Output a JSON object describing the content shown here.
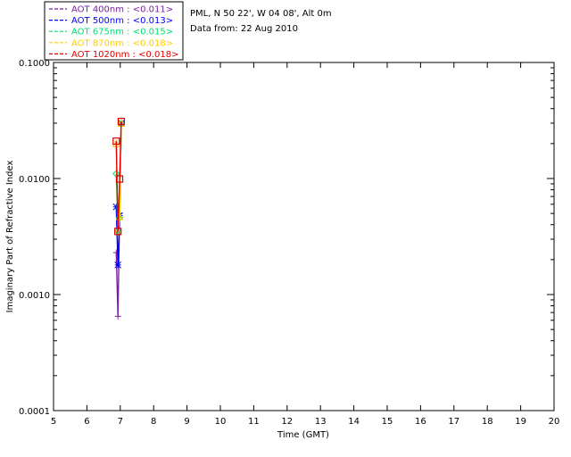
{
  "chart_data": {
    "type": "line",
    "title": "",
    "xlabel": "Time (GMT)",
    "ylabel": "Imaginary Part of Refractive Index",
    "xlim": [
      5,
      20
    ],
    "ylim": [
      0.0001,
      0.1
    ],
    "yscale": "log",
    "x_ticks": [
      "5",
      "6",
      "7",
      "8",
      "9",
      "10",
      "11",
      "12",
      "13",
      "14",
      "15",
      "16",
      "17",
      "18",
      "19",
      "20"
    ],
    "y_ticks": [
      {
        "value": 0.0001,
        "label": "0.0001"
      },
      {
        "value": 0.001,
        "label": "0.0010"
      },
      {
        "value": 0.01,
        "label": "0.0100"
      },
      {
        "value": 0.1,
        "label": "0.1000"
      }
    ],
    "grid": false,
    "legend_position": "top-left-outside",
    "info": [
      "PML, N 50 22', W 04 08', Alt 0m",
      "Data from: 22 Aug 2010"
    ],
    "series": [
      {
        "name": "AOT  400nm : <0.011>",
        "color": "#7a1fa2",
        "marker": "plus",
        "x": [
          6.88,
          6.93,
          6.98,
          7.03
        ],
        "y": [
          0.0023,
          0.00065,
          0.005,
          0.03
        ]
      },
      {
        "name": "AOT  500nm : <0.013>",
        "color": "#0000ff",
        "marker": "asterisk",
        "x": [
          6.88,
          6.93,
          6.98,
          7.03
        ],
        "y": [
          0.0057,
          0.0018,
          0.0048,
          0.03
        ]
      },
      {
        "name": "AOT  675nm : <0.015>",
        "color": "#00e070",
        "marker": "diamond",
        "x": [
          6.88,
          6.93,
          6.98,
          7.03
        ],
        "y": [
          0.011,
          0.0035,
          0.0046,
          0.03
        ]
      },
      {
        "name": "AOT  870nm : <0.018>",
        "color": "#ffcc00",
        "marker": "triangle",
        "x": [
          6.88,
          6.93,
          6.98,
          7.03
        ],
        "y": [
          0.02,
          0.0035,
          0.0047,
          0.03
        ]
      },
      {
        "name": "AOT 1020nm : <0.018>",
        "color": "#e00000",
        "marker": "square",
        "x": [
          6.88,
          6.93,
          6.98,
          7.03
        ],
        "y": [
          0.021,
          0.0035,
          0.0099,
          0.031
        ]
      }
    ]
  }
}
